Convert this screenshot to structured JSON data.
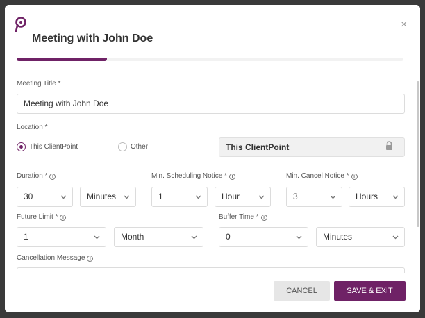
{
  "header": {
    "title": "Meeting with John Doe",
    "close_symbol": "×"
  },
  "form": {
    "meeting_title": {
      "label": "Meeting Title *",
      "value": "Meeting with John Doe"
    },
    "location": {
      "label": "Location *",
      "options": [
        {
          "label": "This ClientPoint",
          "selected": true
        },
        {
          "label": "Other",
          "selected": false
        }
      ],
      "value": "This ClientPoint"
    },
    "duration": {
      "label": "Duration *",
      "amount": "30",
      "unit": "Minutes"
    },
    "min_scheduling_notice": {
      "label": "Min. Scheduling Notice *",
      "amount": "1",
      "unit": "Hour"
    },
    "min_cancel_notice": {
      "label": "Min. Cancel Notice *",
      "amount": "3",
      "unit": "Hours"
    },
    "future_limit": {
      "label": "Future Limit *",
      "amount": "1",
      "unit": "Month"
    },
    "buffer_time": {
      "label": "Buffer Time *",
      "amount": "0",
      "unit": "Minutes"
    },
    "cancellation_message": {
      "label": "Cancellation Message",
      "value": ""
    }
  },
  "footer": {
    "cancel_label": "CANCEL",
    "save_label": "SAVE & EXIT"
  },
  "colors": {
    "accent": "#6f2266",
    "overlay": "#3a3a3a"
  },
  "icons": {
    "info": "i"
  }
}
